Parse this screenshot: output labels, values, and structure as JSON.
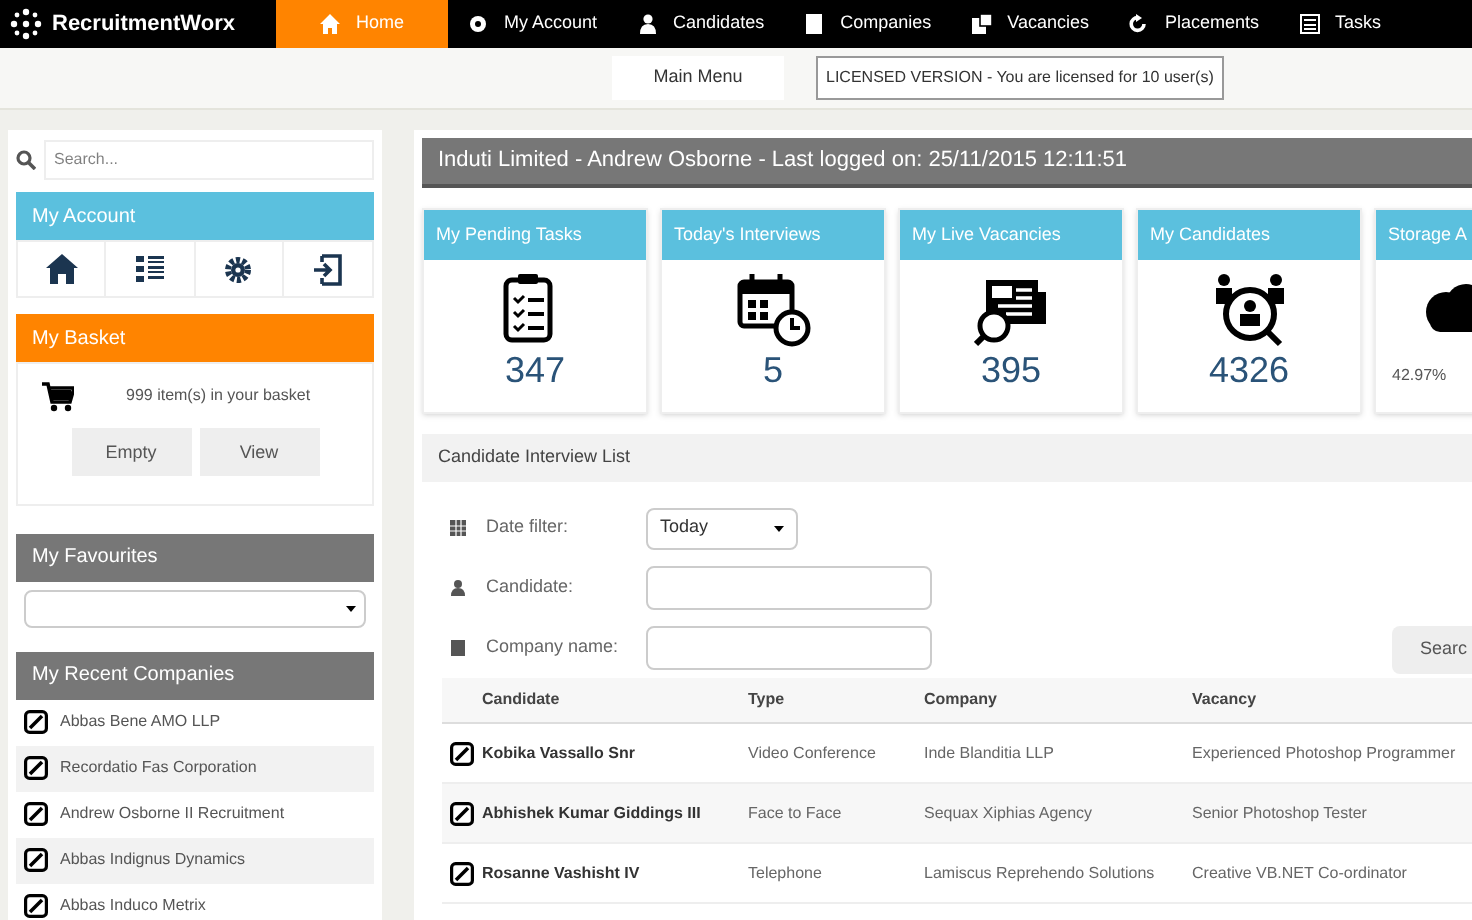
{
  "brand": "RecruitmentWorx",
  "nav": [
    {
      "label": "Home",
      "selected": true
    },
    {
      "label": "My Account",
      "selected": false
    },
    {
      "label": "Candidates",
      "selected": false
    },
    {
      "label": "Companies",
      "selected": false
    },
    {
      "label": "Vacancies",
      "selected": false
    },
    {
      "label": "Placements",
      "selected": false
    },
    {
      "label": "Tasks",
      "selected": false
    }
  ],
  "main_menu_button": "Main Menu",
  "license_notice": "LICENSED VERSION - You are licensed for 10 user(s)",
  "sidebar": {
    "search": {
      "placeholder": "Search..."
    },
    "my_account": {
      "title": "My Account"
    },
    "basket": {
      "title": "My Basket",
      "summary": "999 item(s) in your basket",
      "buttons": [
        "Empty",
        "View"
      ]
    },
    "favourites": {
      "title": "My Favourites"
    },
    "recent_companies": {
      "title": "My Recent Companies",
      "items": [
        "Abbas Bene AMO LLP",
        "Recordatio Fas Corporation",
        "Andrew Osborne II Recruitment",
        "Abbas Indignus Dynamics",
        "Abbas Induco Metrix"
      ]
    }
  },
  "header_bar": "Induti Limited - Andrew Osborne - Last logged on: 25/11/2015 12:11:51",
  "stats": [
    {
      "title": "My Pending Tasks",
      "value": "347",
      "kind": "count"
    },
    {
      "title": "Today's Interviews",
      "value": "5",
      "kind": "count"
    },
    {
      "title": "My Live Vacancies",
      "value": "395",
      "kind": "count"
    },
    {
      "title": "My Candidates",
      "value": "4326",
      "kind": "count"
    },
    {
      "title": "Storage A",
      "value": "42.97%",
      "kind": "percent"
    }
  ],
  "interview_list": {
    "title": "Candidate Interview List",
    "filters": [
      {
        "label": "Date filter:",
        "kind": "select",
        "value": "Today"
      },
      {
        "label": "Candidate:",
        "kind": "text"
      },
      {
        "label": "Company name:",
        "kind": "text"
      }
    ],
    "search_button": "Searc",
    "columns": [
      "Candidate",
      "Type",
      "Company",
      "Vacancy"
    ],
    "rows": [
      [
        "Kobika Vassallo Snr",
        "Video Conference",
        "Inde Blanditia LLP",
        "Experienced Photoshop Programmer"
      ],
      [
        "Abhishek Kumar Giddings III",
        "Face to Face",
        "Sequax Xiphias Agency",
        "Senior Photoshop Tester"
      ],
      [
        "Rosanne Vashisht IV",
        "Telephone",
        "Lamiscus Reprehendo Solutions",
        "Creative VB.NET Co-ordinator"
      ]
    ]
  }
}
